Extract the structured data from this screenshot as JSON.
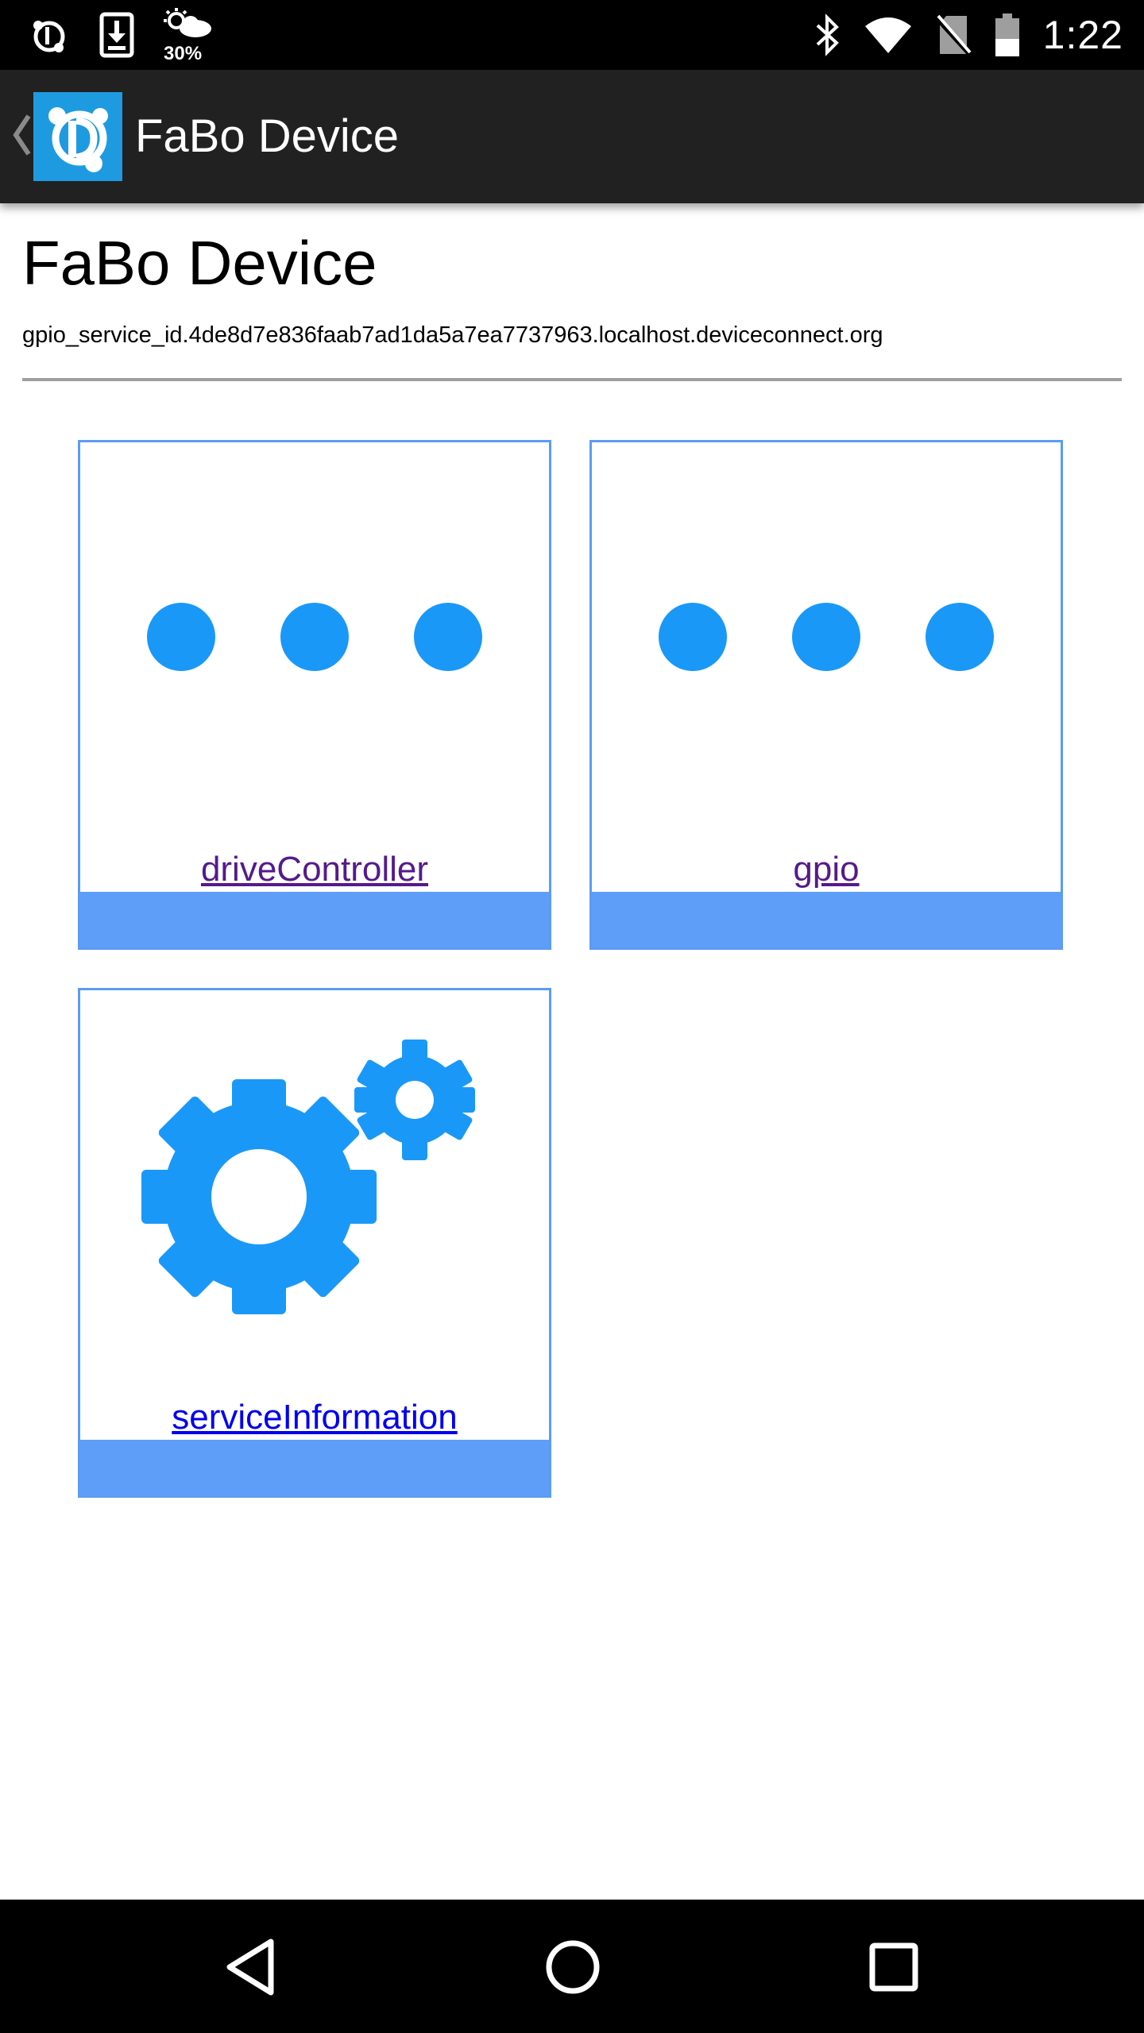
{
  "status_bar": {
    "time": "1:22",
    "battery_saver_label": "30%",
    "left_icons": [
      "device-connect-notification-icon",
      "download-icon",
      "weather-icon"
    ],
    "right_icons": [
      "bluetooth-icon",
      "wifi-icon",
      "no-sim-icon",
      "battery-icon"
    ]
  },
  "action_bar": {
    "title": "FaBo Device",
    "logo_icon": "device-connect-logo-icon",
    "back_icon": "chevron-left-icon"
  },
  "page": {
    "title": "FaBo Device",
    "service_id": "gpio_service_id.4de8d7e836faab7ad1da5a7ea7737963.localhost.deviceconnect.org"
  },
  "cards": [
    {
      "label": "driveController",
      "icon": "more-dots-icon",
      "visited": true
    },
    {
      "label": "gpio",
      "icon": "more-dots-icon",
      "visited": true
    },
    {
      "label": "serviceInformation",
      "icon": "gears-icon",
      "visited": false
    }
  ],
  "colors": {
    "card_border": "#5b9cf5",
    "card_bar": "#5e9ef8",
    "icon_blue": "#1a98f8",
    "action_bar": "#212121"
  },
  "nav_bar": {
    "buttons": [
      "back-triangle-icon",
      "home-circle-icon",
      "recents-square-icon"
    ]
  }
}
